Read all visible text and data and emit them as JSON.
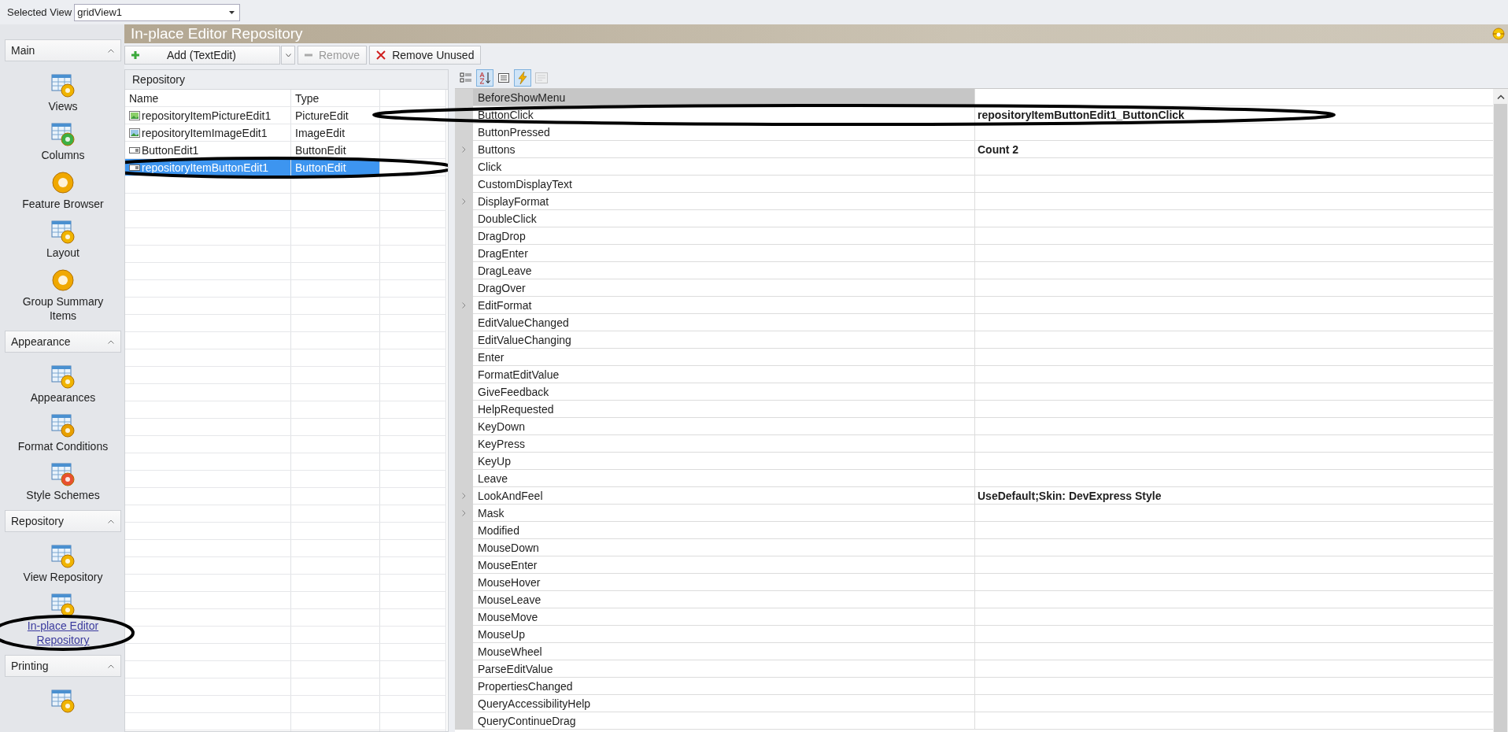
{
  "selected_view": {
    "label": "Selected View",
    "value": "gridView1"
  },
  "sidebar": {
    "groups": [
      {
        "title": "Main",
        "items": [
          {
            "label": "Views",
            "kind": "views",
            "selected": false
          },
          {
            "label": "Columns",
            "kind": "columns",
            "selected": false
          },
          {
            "label": "Feature Browser",
            "kind": "feature",
            "selected": false
          },
          {
            "label": "Layout",
            "kind": "layout",
            "selected": false
          },
          {
            "label": "Group Summary Items",
            "kind": "summary",
            "selected": false
          }
        ]
      },
      {
        "title": "Appearance",
        "items": [
          {
            "label": "Appearances",
            "kind": "appearances",
            "selected": false
          },
          {
            "label": "Format Conditions",
            "kind": "format",
            "selected": false
          },
          {
            "label": "Style Schemes",
            "kind": "schemes",
            "selected": false
          }
        ]
      },
      {
        "title": "Repository",
        "items": [
          {
            "label": "View Repository",
            "kind": "viewrepo",
            "selected": false
          },
          {
            "label": "In-place Editor Repository",
            "kind": "editorrepo",
            "selected": true
          }
        ]
      },
      {
        "title": "Printing",
        "items": [
          {
            "kind": "printing"
          }
        ]
      }
    ]
  },
  "panel": {
    "title": "In-place Editor Repository"
  },
  "toolbar": [
    {
      "kind": "add",
      "label": "Add (TextEdit)",
      "disabled": false
    },
    {
      "kind": "remove",
      "label": "Remove",
      "disabled": true
    },
    {
      "kind": "remove_unused",
      "label": "Remove Unused",
      "disabled": false
    }
  ],
  "repository": {
    "title": "Repository",
    "columns": [
      "Name",
      "Type"
    ],
    "rows": [
      {
        "name": "repositoryItemPictureEdit1",
        "type": "PictureEdit",
        "kind": "picture",
        "selected": false
      },
      {
        "name": "repositoryItemImageEdit1",
        "type": "ImageEdit",
        "kind": "image",
        "selected": false
      },
      {
        "name": "ButtonEdit1",
        "type": "ButtonEdit",
        "kind": "button",
        "selected": false
      },
      {
        "name": "repositoryItemButtonEdit1",
        "type": "ButtonEdit",
        "kind": "button",
        "selected": true
      }
    ]
  },
  "property_toolbar": [
    {
      "kind": "categorized",
      "selected": false,
      "disabled": false
    },
    {
      "kind": "alphabetical",
      "selected": true,
      "disabled": false
    },
    {
      "kind": "properties",
      "selected": false,
      "disabled": false
    },
    {
      "kind": "events",
      "selected": true,
      "disabled": false
    },
    {
      "kind": "pages",
      "selected": false,
      "disabled": true
    }
  ],
  "properties": [
    {
      "name": "BeforeShowMenu",
      "selected": true,
      "expandable": false
    },
    {
      "name": "ButtonClick",
      "value": "repositoryItemButtonEdit1_ButtonClick",
      "selected": false,
      "expandable": false
    },
    {
      "name": "ButtonPressed",
      "selected": false,
      "expandable": false
    },
    {
      "name": "Buttons",
      "value": "Count 2",
      "selected": false,
      "expandable": true
    },
    {
      "name": "Click",
      "selected": false,
      "expandable": false
    },
    {
      "name": "CustomDisplayText",
      "selected": false,
      "expandable": false
    },
    {
      "name": "DisplayFormat",
      "selected": false,
      "expandable": true
    },
    {
      "name": "DoubleClick",
      "selected": false,
      "expandable": false
    },
    {
      "name": "DragDrop",
      "selected": false,
      "expandable": false
    },
    {
      "name": "DragEnter",
      "selected": false,
      "expandable": false
    },
    {
      "name": "DragLeave",
      "selected": false,
      "expandable": false
    },
    {
      "name": "DragOver",
      "selected": false,
      "expandable": false
    },
    {
      "name": "EditFormat",
      "selected": false,
      "expandable": true
    },
    {
      "name": "EditValueChanged",
      "selected": false,
      "expandable": false
    },
    {
      "name": "EditValueChanging",
      "selected": false,
      "expandable": false
    },
    {
      "name": "Enter",
      "selected": false,
      "expandable": false
    },
    {
      "name": "FormatEditValue",
      "selected": false,
      "expandable": false
    },
    {
      "name": "GiveFeedback",
      "selected": false,
      "expandable": false
    },
    {
      "name": "HelpRequested",
      "selected": false,
      "expandable": false
    },
    {
      "name": "KeyDown",
      "selected": false,
      "expandable": false
    },
    {
      "name": "KeyPress",
      "selected": false,
      "expandable": false
    },
    {
      "name": "KeyUp",
      "selected": false,
      "expandable": false
    },
    {
      "name": "Leave",
      "selected": false,
      "expandable": false
    },
    {
      "name": "LookAndFeel",
      "value": "UseDefault;Skin: DevExpress Style",
      "selected": false,
      "expandable": true
    },
    {
      "name": "Mask",
      "selected": false,
      "expandable": true
    },
    {
      "name": "Modified",
      "selected": false,
      "expandable": false
    },
    {
      "name": "MouseDown",
      "selected": false,
      "expandable": false
    },
    {
      "name": "MouseEnter",
      "selected": false,
      "expandable": false
    },
    {
      "name": "MouseHover",
      "selected": false,
      "expandable": false
    },
    {
      "name": "MouseLeave",
      "selected": false,
      "expandable": false
    },
    {
      "name": "MouseMove",
      "selected": false,
      "expandable": false
    },
    {
      "name": "MouseUp",
      "selected": false,
      "expandable": false
    },
    {
      "name": "MouseWheel",
      "selected": false,
      "expandable": false
    },
    {
      "name": "ParseEditValue",
      "selected": false,
      "expandable": false
    },
    {
      "name": "PropertiesChanged",
      "selected": false,
      "expandable": false
    },
    {
      "name": "QueryAccessibilityHelp",
      "selected": false,
      "expandable": false
    },
    {
      "name": "QueryContinueDrag",
      "selected": false,
      "expandable": false
    }
  ]
}
